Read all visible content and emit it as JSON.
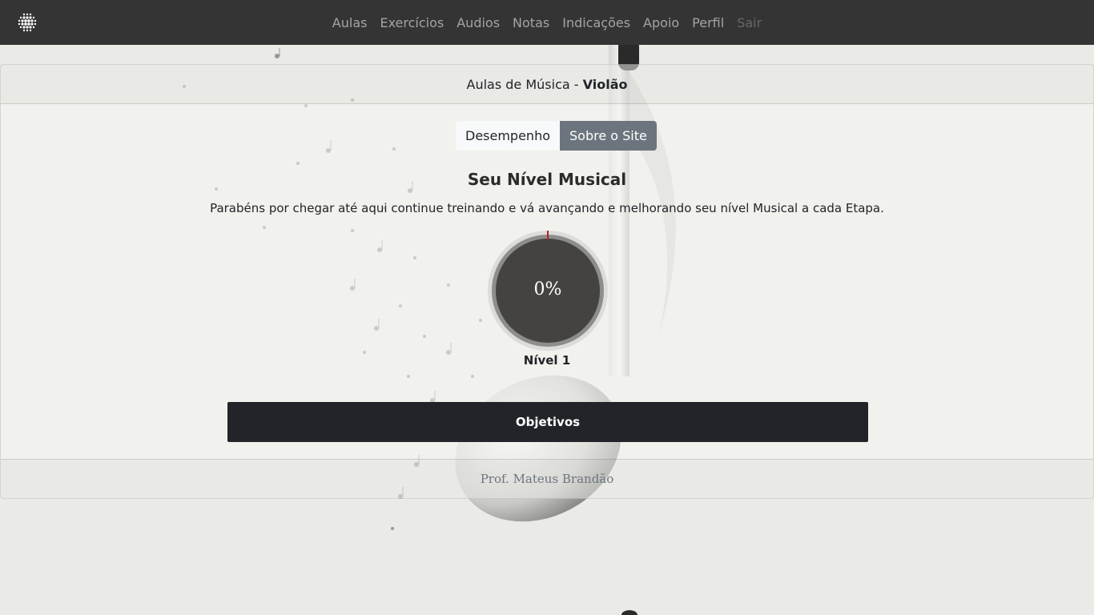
{
  "nav": {
    "brand_icon": "dots-grid-logo-icon",
    "links": [
      {
        "label": "Aulas"
      },
      {
        "label": "Exercícios"
      },
      {
        "label": "Audios"
      },
      {
        "label": "Notas"
      },
      {
        "label": "Indicações"
      },
      {
        "label": "Apoio"
      },
      {
        "label": "Perfil"
      },
      {
        "label": "Sair"
      }
    ]
  },
  "card": {
    "header_prefix": "Aulas de Música - ",
    "header_course": "Violão",
    "footer": "Prof. Mateus Brandão"
  },
  "tabs": {
    "performance": "Desempenho",
    "about": "Sobre o Site"
  },
  "level": {
    "title": "Seu Nível Musical",
    "text": "Parabéns por chegar até aqui continue treinando e vá avançando e melhorando seu nível Musical a cada Etapa.",
    "progress_label": "0%",
    "progress_fraction": 0,
    "name": "Nível 1"
  },
  "actions": {
    "objectives": "Objetivos"
  },
  "colors": {
    "navbar": "#343434",
    "dark_button": "#212529",
    "ring_fill": "#454342",
    "progress_marker": "#b22222"
  }
}
